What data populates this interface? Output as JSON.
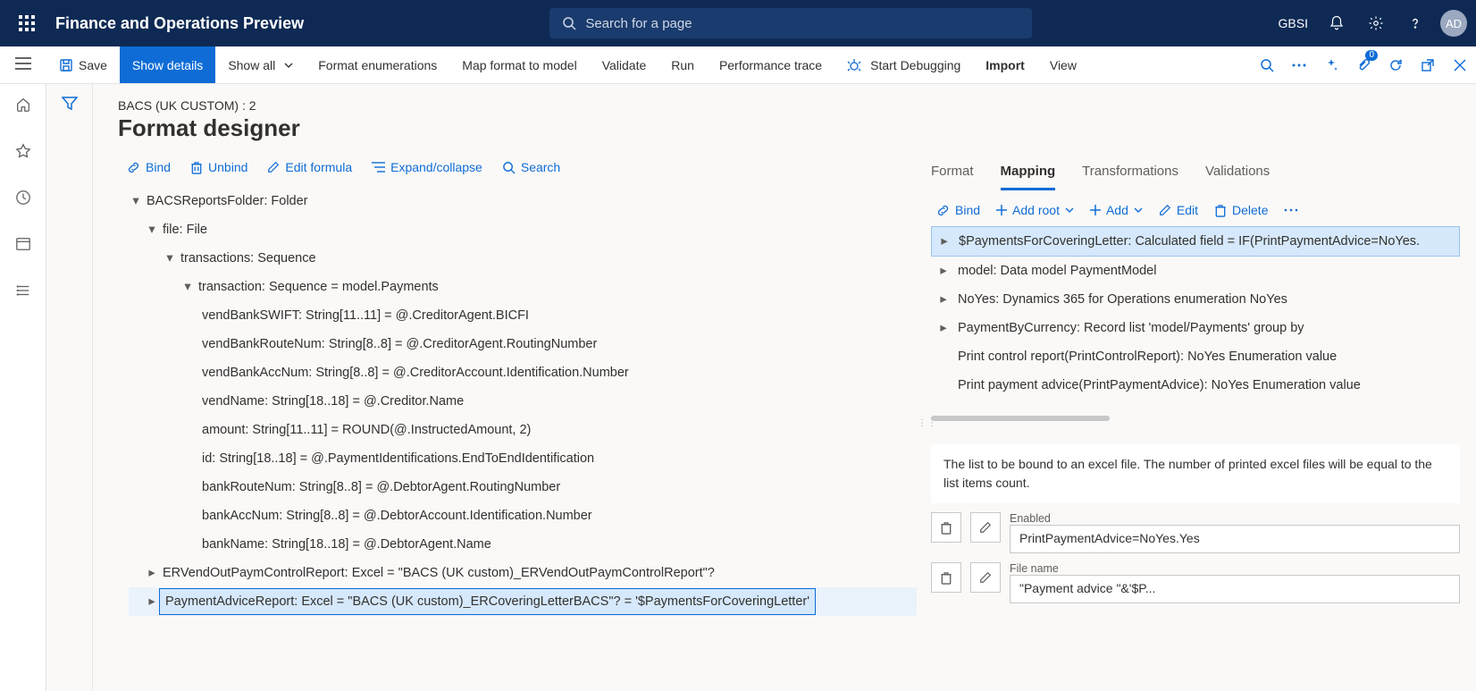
{
  "header": {
    "app_title": "Finance and Operations Preview",
    "search_placeholder": "Search for a page",
    "tenant": "GBSI",
    "avatar": "AD"
  },
  "toolbar": {
    "save": "Save",
    "show_details": "Show details",
    "show_all": "Show all",
    "format_enum": "Format enumerations",
    "map_format": "Map format to model",
    "validate": "Validate",
    "run": "Run",
    "perf_trace": "Performance trace",
    "start_debug": "Start Debugging",
    "import": "Import",
    "view": "View",
    "notif_badge": "0"
  },
  "page": {
    "breadcrumb": "BACS (UK CUSTOM) : 2",
    "title": "Format designer"
  },
  "left_actions": {
    "bind": "Bind",
    "unbind": "Unbind",
    "edit_formula": "Edit formula",
    "expand": "Expand/collapse",
    "search": "Search"
  },
  "tree": {
    "n0": "BACSReportsFolder: Folder",
    "n1": "file: File",
    "n2": "transactions: Sequence",
    "n3": "transaction: Sequence = model.Payments",
    "leaves": [
      "vendBankSWIFT: String[11..11] = @.CreditorAgent.BICFI",
      "vendBankRouteNum: String[8..8] = @.CreditorAgent.RoutingNumber",
      "vendBankAccNum: String[8..8] = @.CreditorAccount.Identification.Number",
      "vendName: String[18..18] = @.Creditor.Name",
      "amount: String[11..11] = ROUND(@.InstructedAmount, 2)",
      "id: String[18..18] = @.PaymentIdentifications.EndToEndIdentification",
      "bankRouteNum: String[8..8] = @.DebtorAgent.RoutingNumber",
      "bankAccNum: String[8..8] = @.DebtorAccount.Identification.Number",
      "bankName: String[18..18] = @.DebtorAgent.Name"
    ],
    "n4": "ERVendOutPaymControlReport: Excel = \"BACS (UK custom)_ERVendOutPaymControlReport\"?",
    "n5": "PaymentAdviceReport: Excel = \"BACS (UK custom)_ERCoveringLetterBACS\"? = '$PaymentsForCoveringLetter'"
  },
  "tabs": {
    "format": "Format",
    "mapping": "Mapping",
    "transformations": "Transformations",
    "validations": "Validations"
  },
  "right_actions": {
    "bind": "Bind",
    "add_root": "Add root",
    "add": "Add",
    "edit": "Edit",
    "delete": "Delete"
  },
  "ds": {
    "r0": "$PaymentsForCoveringLetter: Calculated field = IF(PrintPaymentAdvice=NoYes.",
    "r1": "model: Data model PaymentModel",
    "r2": "NoYes: Dynamics 365 for Operations enumeration NoYes",
    "r3": "PaymentByCurrency: Record list 'model/Payments' group by",
    "r4": "Print control report(PrintControlReport): NoYes Enumeration value",
    "r5": "Print payment advice(PrintPaymentAdvice): NoYes Enumeration value"
  },
  "desc": "The list to be bound to an excel file. The number of printed excel files will be equal to the list items count.",
  "props": {
    "enabled_label": "Enabled",
    "enabled_value": "PrintPaymentAdvice=NoYes.Yes",
    "filename_label": "File name",
    "filename_value": "\"Payment advice \"&'$P..."
  }
}
